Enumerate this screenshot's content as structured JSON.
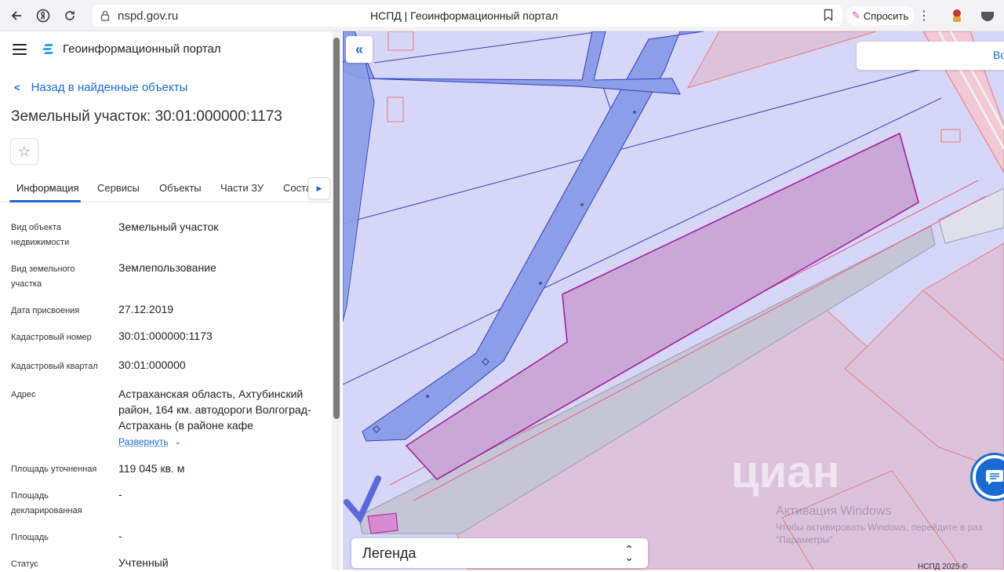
{
  "browser": {
    "url": "nspd.gov.ru",
    "page_title": "НСПД | Геоинформационный портал",
    "ask_label": "Спросить"
  },
  "header": {
    "portal_title": "Геоинформационный портал"
  },
  "back_link": "Назад в найденные объекты",
  "object_title": "Земельный участок: 30:01:000000:1173",
  "tabs": [
    "Информация",
    "Сервисы",
    "Объекты",
    "Части ЗУ",
    "Соста"
  ],
  "info": [
    {
      "label": "Вид объекта недвижимости",
      "value": "Земельный участок"
    },
    {
      "label": "Вид земельного участка",
      "value": "Землепользование"
    },
    {
      "label": "Дата присвоения",
      "value": "27.12.2019"
    },
    {
      "label": "Кадастровый номер",
      "value": "30:01:000000:1173"
    },
    {
      "label": "Кадастровый квартал",
      "value": "30:01:000000"
    },
    {
      "label": "Адрес",
      "value": "Астраханская область, Ахтубинский район, 164 км. автодороги Волгоград-Астрахань (в районе кафе"
    },
    {
      "label": "Площадь уточненная",
      "value": "119 045 кв. м"
    },
    {
      "label": "Площадь декларированная",
      "value": "-"
    },
    {
      "label": "Площадь",
      "value": "-"
    },
    {
      "label": "Статус",
      "value": "Учтенный"
    }
  ],
  "expand_label": "Развернуть",
  "map": {
    "search_partial": "Во",
    "legend_label": "Легенда",
    "watermark": "циан",
    "copyright": "НСПД 2025 ©"
  },
  "windows_activation": {
    "title": "Активация Windows",
    "subtitle": "Чтобы активировать Windows, перейдите в раз \"Параметры\"."
  },
  "icons": {
    "back": "arrow-left-icon",
    "yandex": "yandex-icon",
    "reload": "reload-icon",
    "lock": "lock-icon",
    "bookmark": "bookmark-icon",
    "star": "star-icon",
    "chat": "chat-icon"
  },
  "colors": {
    "accent": "#1a6bd1",
    "parcel_fill": "#c9a8d8",
    "parcel_stroke": "#a020a0",
    "road_fill": "#8c9ee8",
    "map_bg": "#d6d6f6"
  }
}
